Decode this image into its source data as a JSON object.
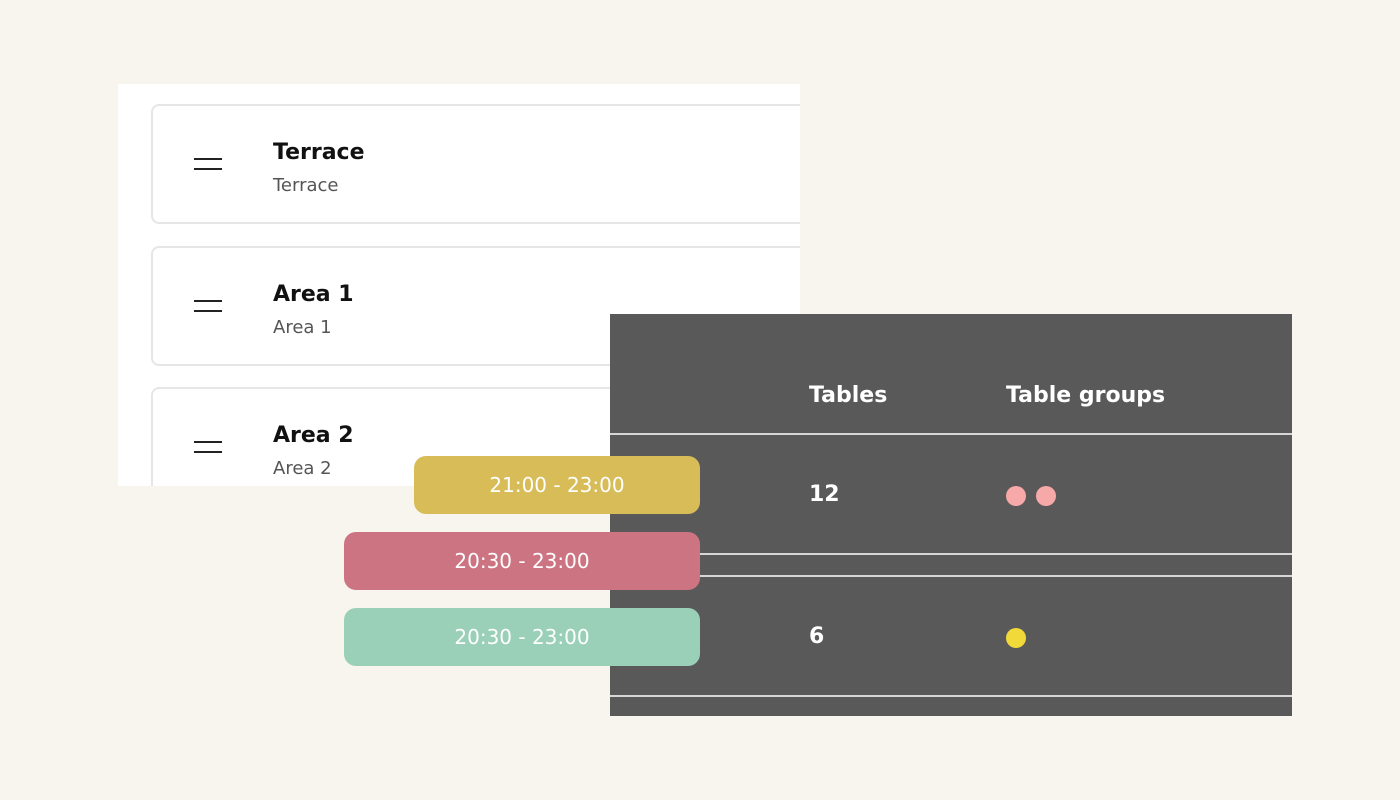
{
  "areas": [
    {
      "name": "Terrace",
      "subtitle": "Terrace"
    },
    {
      "name": "Area 1",
      "subtitle": "Area 1"
    },
    {
      "name": "Area 2",
      "subtitle": "Area 2"
    }
  ],
  "tables_panel": {
    "columns": {
      "tables": "Tables",
      "table_groups": "Table groups"
    },
    "rows": [
      {
        "tables": "12",
        "group_dots": [
          "#f7a8a8",
          "#f7a8a8"
        ]
      },
      {
        "tables": "6",
        "group_dots": [
          "#f1d93a"
        ]
      }
    ]
  },
  "time_slots": [
    {
      "label": "21:00 - 23:00",
      "color": "#d8bc58"
    },
    {
      "label": "20:30 - 23:00",
      "color": "#cd7483"
    },
    {
      "label": "20:30 - 23:00",
      "color": "#99d0b7"
    }
  ],
  "colors": {
    "background": "#f8f5ee",
    "panel_dark": "#595959"
  }
}
